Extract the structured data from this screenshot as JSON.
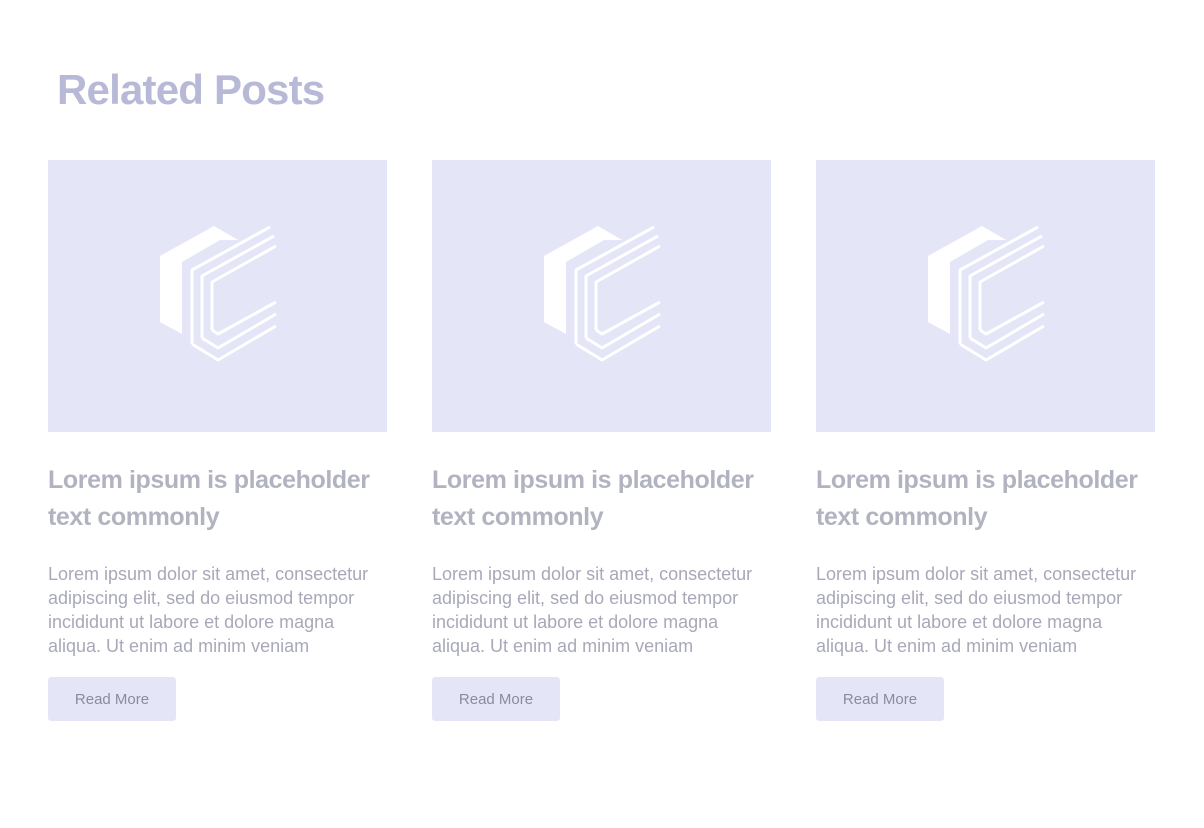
{
  "section": {
    "title": "Related Posts"
  },
  "colors": {
    "title": "#b7b9d6",
    "placeholder_bg": "#e5e5f8",
    "card_title": "#b2b3c1",
    "card_text": "#a8a9b8",
    "button_text": "#8a8c9c"
  },
  "posts": [
    {
      "image_icon": "cube-logo-icon",
      "title": "Lorem ipsum is placeholder text commonly",
      "excerpt": "Lorem ipsum dolor sit amet, consectetur adipiscing elit, sed do eiusmod tempor incididunt ut labore et dolore magna aliqua. Ut enim ad minim veniam",
      "button_label": "Read More"
    },
    {
      "image_icon": "cube-logo-icon",
      "title": "Lorem ipsum is placeholder text commonly",
      "excerpt": "Lorem ipsum dolor sit amet, consectetur adipiscing elit, sed do eiusmod tempor incididunt ut labore et dolore magna aliqua. Ut enim ad minim veniam",
      "button_label": "Read More"
    },
    {
      "image_icon": "cube-logo-icon",
      "title": "Lorem ipsum is placeholder text commonly",
      "excerpt": "Lorem ipsum dolor sit amet, consectetur adipiscing elit, sed do eiusmod tempor incididunt ut labore et dolore magna aliqua. Ut enim ad minim veniam",
      "button_label": "Read More"
    }
  ]
}
